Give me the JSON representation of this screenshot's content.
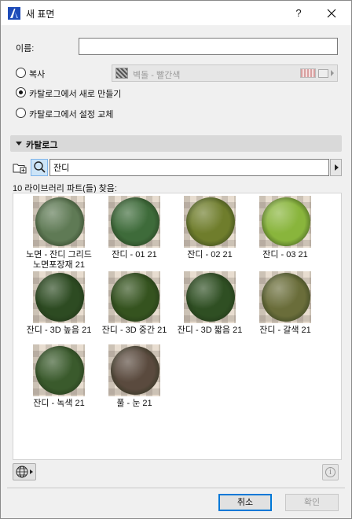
{
  "window": {
    "title": "새 표면"
  },
  "form": {
    "name_label": "이름:",
    "name_value": "",
    "duplicate_label": "복사",
    "duplicate_source": "벽돌 - 빨간색",
    "create_new_label": "카탈로그에서 새로 만들기",
    "replace_label": "카탈로그에서 설정 교체",
    "selected_option": "create_new"
  },
  "catalog": {
    "title": "카탈로그",
    "search_value": "잔디",
    "result_count": "10 라이브러리 파트(들) 찾음:",
    "items": [
      {
        "label": "노면 - 잔디 그리드 노면포장재 21",
        "color": "#5f7a55"
      },
      {
        "label": "잔디 - 01 21",
        "color": "#3e6b3a"
      },
      {
        "label": "잔디 - 02 21",
        "color": "#6f7d2c"
      },
      {
        "label": "잔디 - 03 21",
        "color": "#89b53c"
      },
      {
        "label": "잔디 - 3D 높음 21",
        "color": "#2d4b22"
      },
      {
        "label": "잔디 - 3D 중간 21",
        "color": "#35531f"
      },
      {
        "label": "잔디 - 3D 짧음 21",
        "color": "#2f4f23"
      },
      {
        "label": "잔디 - 갈색 21",
        "color": "#6a6d3a"
      },
      {
        "label": "잔디 - 녹색 21",
        "color": "#3a5a2c"
      },
      {
        "label": "풀 - 눈 21",
        "color": "#5a4a3e"
      }
    ]
  },
  "buttons": {
    "cancel": "취소",
    "ok": "확인"
  },
  "colors": {
    "accent": "#0078d7",
    "search_active": "#cce4f7"
  }
}
